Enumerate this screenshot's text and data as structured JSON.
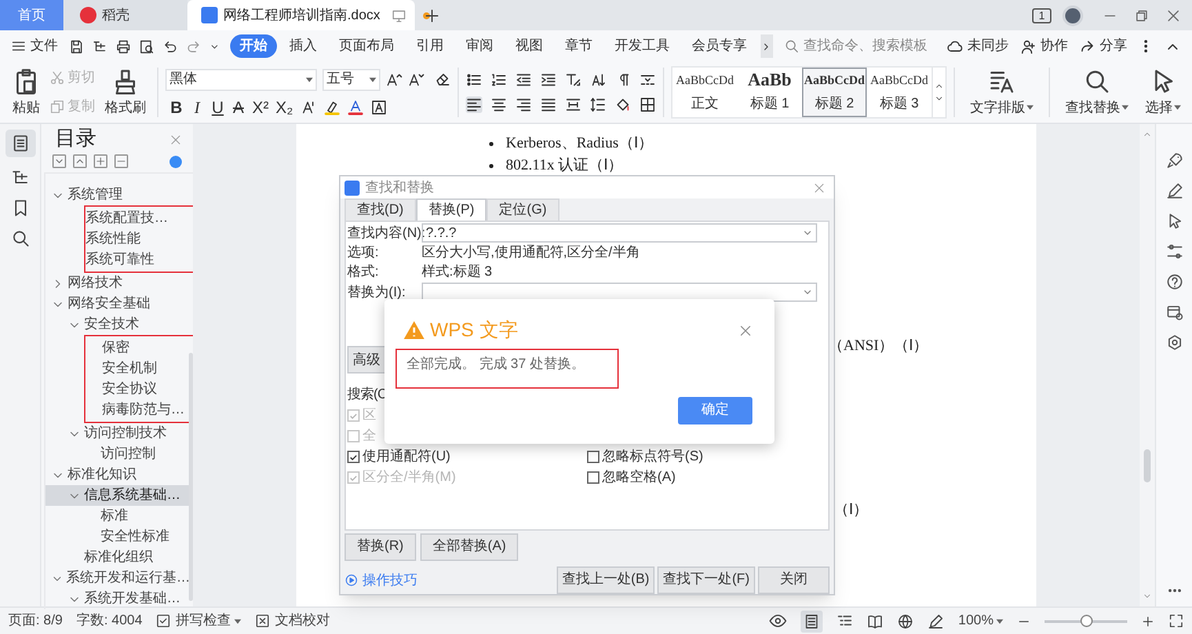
{
  "tab_bar": {
    "tabs": [
      {
        "label": "首页",
        "kind": "home",
        "selected": false
      },
      {
        "label": "稻壳",
        "kind": "app",
        "selected": false
      },
      {
        "label": "网络工程师培训指南.docx",
        "kind": "document",
        "selected": true
      }
    ],
    "page_badge": "1"
  },
  "menu_bar": {
    "file_label": "文件",
    "tabs": [
      {
        "label": "开始",
        "selected": true
      },
      {
        "label": "插入",
        "selected": false
      },
      {
        "label": "页面布局",
        "selected": false
      },
      {
        "label": "引用",
        "selected": false
      },
      {
        "label": "审阅",
        "selected": false
      },
      {
        "label": "视图",
        "selected": false
      },
      {
        "label": "章节",
        "selected": false
      },
      {
        "label": "开发工具",
        "selected": false
      },
      {
        "label": "会员专享",
        "selected": false
      }
    ],
    "search": {
      "placeholder": "查找命令、搜索模板"
    },
    "actions": [
      "未同步",
      "协作",
      "分享"
    ]
  },
  "ribbon": {
    "paste": "粘贴",
    "cut": {
      "label": "剪切",
      "disabled": true
    },
    "copy": {
      "label": "复制",
      "disabled": true
    },
    "format_painter": "格式刷",
    "font_name": "黑体",
    "font_size": "五号",
    "font_buttons": [
      {
        "label": "B",
        "kind": "bold"
      },
      {
        "label": "I",
        "kind": "italic"
      },
      {
        "label": "U",
        "kind": "underline"
      },
      {
        "label": "A",
        "kind": "strike"
      },
      {
        "label": "X²",
        "kind": "plain"
      },
      {
        "label": "X₂",
        "kind": "plain"
      }
    ],
    "styles": [
      {
        "preview": "AaBbCcDd",
        "label": "正文",
        "selected": false
      },
      {
        "preview": "AaBb",
        "label": "标题 1",
        "selected": false
      },
      {
        "preview": "AaBbCcDd",
        "label": "标题 2",
        "selected": true
      },
      {
        "preview": "AaBbCcDd",
        "label": "标题 3",
        "selected": false
      }
    ],
    "tools": [
      "文字排版",
      "查找替换",
      "选择"
    ]
  },
  "toc": {
    "title": "目录",
    "items": [
      {
        "label": "系统管理",
        "expanded": true,
        "selected": false,
        "marked": false,
        "children": [
          {
            "label": "系统配置技…",
            "selected": false,
            "marked": true
          },
          {
            "label": "系统性能",
            "selected": false,
            "marked": true
          },
          {
            "label": "系统可靠性",
            "selected": false,
            "marked": true
          }
        ]
      },
      {
        "label": "网络技术",
        "expanded": false,
        "selected": false,
        "marked": false
      },
      {
        "label": "网络安全基础",
        "expanded": true,
        "selected": false,
        "marked": false,
        "children": [
          {
            "label": "安全技术",
            "expanded": true,
            "selected": false,
            "marked": false,
            "children": [
              {
                "label": "保密",
                "selected": false,
                "marked": true
              },
              {
                "label": "安全机制",
                "selected": false,
                "marked": true
              },
              {
                "label": "安全协议",
                "selected": false,
                "marked": true
              },
              {
                "label": "病毒防范与…",
                "selected": false,
                "marked": true
              }
            ]
          },
          {
            "label": "访问控制技术",
            "expanded": true,
            "selected": false,
            "marked": false,
            "children": [
              {
                "label": "访问控制",
                "selected": false,
                "marked": false
              }
            ]
          }
        ]
      },
      {
        "label": "标准化知识",
        "expanded": true,
        "selected": false,
        "marked": false,
        "children": [
          {
            "label": "信息系统基础…",
            "expanded": true,
            "selected": true,
            "marked": false,
            "children": [
              {
                "label": "标准",
                "selected": false,
                "marked": false
              },
              {
                "label": "安全性标准",
                "selected": false,
                "marked": false
              }
            ]
          },
          {
            "label": "标准化组织",
            "selected": false,
            "marked": false
          }
        ]
      },
      {
        "label": "系统开发和运行基…",
        "expanded": true,
        "selected": false,
        "marked": false,
        "children": [
          {
            "label": "系统开发基础…",
            "expanded": true,
            "selected": false,
            "marked": false
          }
        ]
      }
    ]
  },
  "document": {
    "lines": [
      {
        "text": "Kerberos、Radius（Ⅰ）",
        "kind": "bullet"
      },
      {
        "text": "802.11x 认证（Ⅰ）",
        "kind": "bullet"
      },
      {
        "text": "（ANSI）（Ⅰ）",
        "kind": "fragment"
      },
      {
        "text": "（Ⅰ）",
        "kind": "fragment"
      }
    ]
  },
  "find_replace_dialog": {
    "title": "查找和替换",
    "tabs": [
      {
        "label": "查找(D)",
        "selected": false
      },
      {
        "label": "替换(P)",
        "selected": true
      },
      {
        "label": "定位(G)",
        "selected": false
      }
    ],
    "find_label": "查找内容(N):",
    "find_value": "?.?.?",
    "options_label": "选项:",
    "options_value": "区分大小写,使用通配符,区分全/半角",
    "format_label": "格式:",
    "format_value": "样式:标题 3",
    "replace_label": "替换为(I):",
    "advanced_button": "高级",
    "search_label": "搜索(C",
    "options_left": [
      {
        "label": "区",
        "checked": true,
        "disabled": true
      },
      {
        "label": "全",
        "checked": false,
        "disabled": true
      },
      {
        "label": "使用通配符(U)",
        "checked": true,
        "disabled": false
      },
      {
        "label": "区分全/半角(M)",
        "checked": true,
        "disabled": true
      }
    ],
    "options_right": [
      {
        "label": "忽略标点符号(S)",
        "checked": false,
        "disabled": false
      },
      {
        "label": "忽略空格(A)",
        "checked": false,
        "disabled": false
      }
    ],
    "replace_buttons": [
      "替换(R)",
      "全部替换(A)"
    ],
    "tips_link": "操作技巧",
    "buttons": [
      "查找上一处(B)",
      "查找下一处(F)",
      "关闭"
    ]
  },
  "alert": {
    "title": "WPS 文字",
    "message": "全部完成。 完成 37 处替换。",
    "button": "确定"
  },
  "status_bar": {
    "page": "页面: 8/9",
    "words": "字数: 4004",
    "spell_check": "拼写检查",
    "proofread": "文档校对",
    "zoom": "100%",
    "zoom_slider": {
      "level": 0.5
    }
  }
}
